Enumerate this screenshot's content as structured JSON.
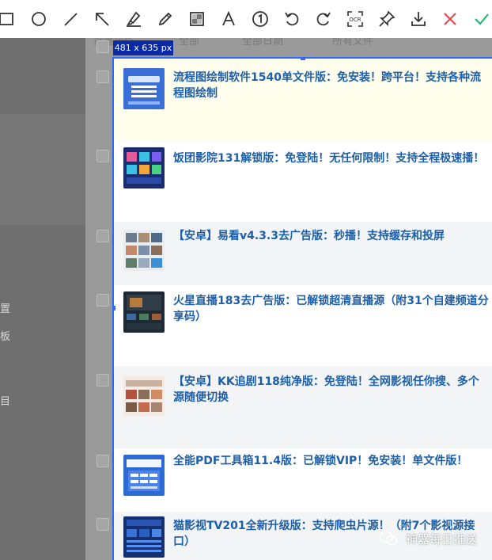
{
  "toolbar": {
    "tools": [
      {
        "name": "rectangle-tool",
        "icon": "rectangle-icon"
      },
      {
        "name": "ellipse-tool",
        "icon": "circle-icon"
      },
      {
        "name": "line-tool",
        "icon": "line-icon"
      },
      {
        "name": "arrow-tool",
        "icon": "arrow-icon"
      },
      {
        "name": "marker-tool",
        "icon": "marker-icon"
      },
      {
        "name": "pencil-tool",
        "icon": "pencil-icon"
      },
      {
        "name": "mosaic-tool",
        "icon": "mosaic-icon"
      },
      {
        "name": "text-tool",
        "icon": "text-icon",
        "label": "A"
      },
      {
        "name": "number-tool",
        "icon": "number-icon",
        "label": "1"
      },
      {
        "name": "undo-button",
        "icon": "undo-icon"
      },
      {
        "name": "redo-button",
        "icon": "redo-icon"
      },
      {
        "name": "ocr-button",
        "icon": "ocr-icon",
        "label": "OCR"
      },
      {
        "name": "pin-button",
        "icon": "pin-icon"
      },
      {
        "name": "download-button",
        "icon": "download-icon"
      },
      {
        "name": "cancel-button",
        "icon": "close-icon",
        "color": "#e8414b"
      },
      {
        "name": "confirm-button",
        "icon": "check-icon",
        "color": "#1bb36a"
      }
    ]
  },
  "selection": {
    "size_label": "481 x 635 px"
  },
  "background": {
    "header_labels": [
      "批量操作",
      "全部",
      "全部日期",
      "所有文件"
    ],
    "side_labels": [
      "置",
      "板",
      "目"
    ]
  },
  "articles": [
    {
      "title": "流程图绘制软件1540单文件版：免安装！跨平台！支持各种流程图绘制",
      "thumb": "software-collection-thumb",
      "highlight": true
    },
    {
      "title": "饭团影院131解锁版：免登陆！无任何限制！支持全程极速播！",
      "thumb": "video-app-thumb",
      "highlight": false
    },
    {
      "title": "【安卓】易看v4.3.3去广告版：秒播！支持缓存和投屏",
      "thumb": "video-grid-thumb",
      "highlight": false
    },
    {
      "title": "火星直播183去广告版：已解锁超清直播源（附31个自建频道分享码）",
      "thumb": "tv-live-thumb",
      "highlight": false
    },
    {
      "title": "【安卓】KK追剧118纯净版：免登陆！全网影视任你搜、多个源随便切换",
      "thumb": "drama-app-thumb",
      "highlight": false
    },
    {
      "title": "全能PDF工具箱11.4版：已解锁VIP！免安装！单文件版！",
      "thumb": "pdf-tools-thumb",
      "highlight": false
    },
    {
      "title": "猫影视TV201全新升级版：支持爬虫片源！（附7个影视源接口）",
      "thumb": "tv-app-thumb",
      "highlight": false
    }
  ],
  "watermark": {
    "text": "神器每日推送"
  }
}
